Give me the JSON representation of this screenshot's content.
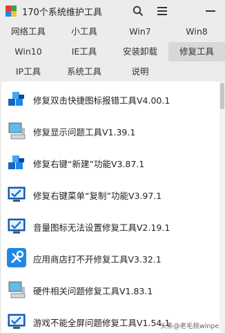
{
  "window": {
    "title": "170个系统维护工具"
  },
  "icons": {
    "search": "search-icon",
    "menu": "hamburger-menu-icon",
    "minimize": "minimize-icon"
  },
  "tabs": [
    {
      "label": "网络工具",
      "active": false
    },
    {
      "label": "小工具",
      "active": false
    },
    {
      "label": "Win7",
      "active": false
    },
    {
      "label": "Win8",
      "active": false
    },
    {
      "label": "Win10",
      "active": false
    },
    {
      "label": "IE工具",
      "active": false
    },
    {
      "label": "安装卸载",
      "active": false
    },
    {
      "label": "修复工具",
      "active": true
    },
    {
      "label": "IP工具",
      "active": false
    },
    {
      "label": "系统工具",
      "active": false
    },
    {
      "label": "说明",
      "active": false
    }
  ],
  "items": [
    {
      "label": "修复双击快捷图标报错工具V4.00.1",
      "icon": "blue-cubes-icon"
    },
    {
      "label": "修复显示问题工具V1.39.1",
      "icon": "computer-icon"
    },
    {
      "label": "修复右键“新建”功能V3.87.1",
      "icon": "blue-cubes-icon"
    },
    {
      "label": "修复右键菜单“复制”功能V3.97.1",
      "icon": "monitor-check-icon"
    },
    {
      "label": "音量图标无法设置修复工具V2.19.1",
      "icon": "monitor-check-icon"
    },
    {
      "label": "应用商店打不开修复工具V3.32.1",
      "icon": "tools-icon"
    },
    {
      "label": "硬件相关问题修复工具V1.83.1",
      "icon": "computer-icon"
    },
    {
      "label": "游戏不能全屏问题修复工具V1.54.1",
      "icon": "monitor-check-icon"
    }
  ],
  "watermark": {
    "text": "头条@老毛桃winpe"
  },
  "colors": {
    "window_bg": "#ececec",
    "active_tab": "#d8d8d8",
    "list_bg": "#ffffff",
    "accent_blue": "#1e88e5"
  }
}
